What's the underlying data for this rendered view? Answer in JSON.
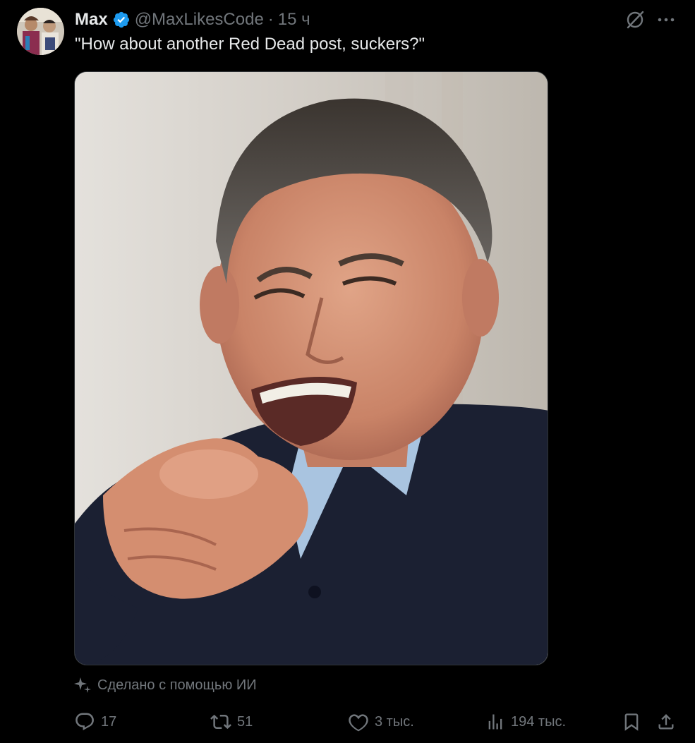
{
  "post": {
    "author_name": "Max",
    "handle": "@MaxLikesCode",
    "separator": "·",
    "time": "15 ч",
    "text": "\"How about another Red Dead post, suckers?\"",
    "ai_label": "Сделано с помощью ИИ"
  },
  "icons": {
    "verified": "verified-badge-icon",
    "grok": "grok-icon",
    "more": "more-icon",
    "sparkle": "sparkle-icon",
    "reply": "reply-icon",
    "repost": "repost-icon",
    "like": "heart-icon",
    "views": "views-icon",
    "bookmark": "bookmark-icon",
    "share": "share-icon"
  },
  "actions": {
    "replies": "17",
    "reposts": "51",
    "likes": "3 тыс.",
    "views": "194 тыс."
  },
  "colors": {
    "background": "#000000",
    "text_primary": "#e7e9ea",
    "text_secondary": "#71767b",
    "verified_blue": "#1d9bf0"
  }
}
